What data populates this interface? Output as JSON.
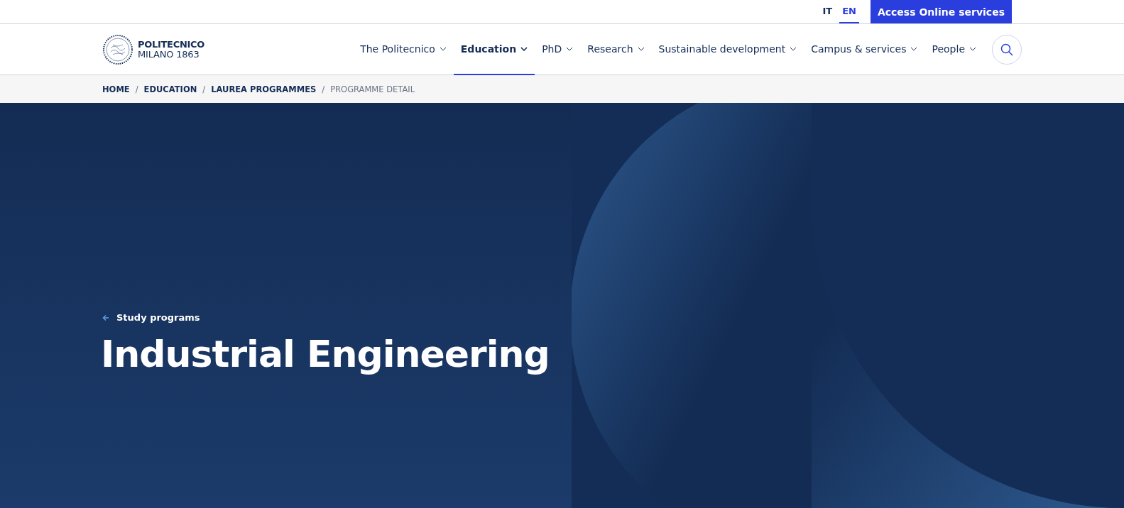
{
  "top_bar": {
    "languages": [
      {
        "label": "IT",
        "selected": false
      },
      {
        "label": "EN",
        "selected": true
      }
    ],
    "services_button": "Access Online services"
  },
  "header": {
    "logo": {
      "name": "POLITECNICO",
      "subtitle": "MILANO 1863"
    },
    "nav": [
      {
        "label": "The Politecnico",
        "selected": false
      },
      {
        "label": "Education",
        "selected": true
      },
      {
        "label": "PhD",
        "selected": false
      },
      {
        "label": "Research",
        "selected": false
      },
      {
        "label": "Sustainable development",
        "selected": false
      },
      {
        "label": "Campus & services",
        "selected": false
      },
      {
        "label": "People",
        "selected": false
      }
    ]
  },
  "breadcrumb": [
    {
      "label": "HOME",
      "current": false
    },
    {
      "separator": "/",
      "label": "EDUCATION",
      "current": false
    },
    {
      "separator": "/",
      "label": "LAUREA PROGRAMMES",
      "current": false
    },
    {
      "separator": "/",
      "label": "PROGRAMME DETAIL",
      "current": true
    }
  ],
  "hero": {
    "back_link": "Study programs",
    "title": "Industrial Engineering"
  }
}
